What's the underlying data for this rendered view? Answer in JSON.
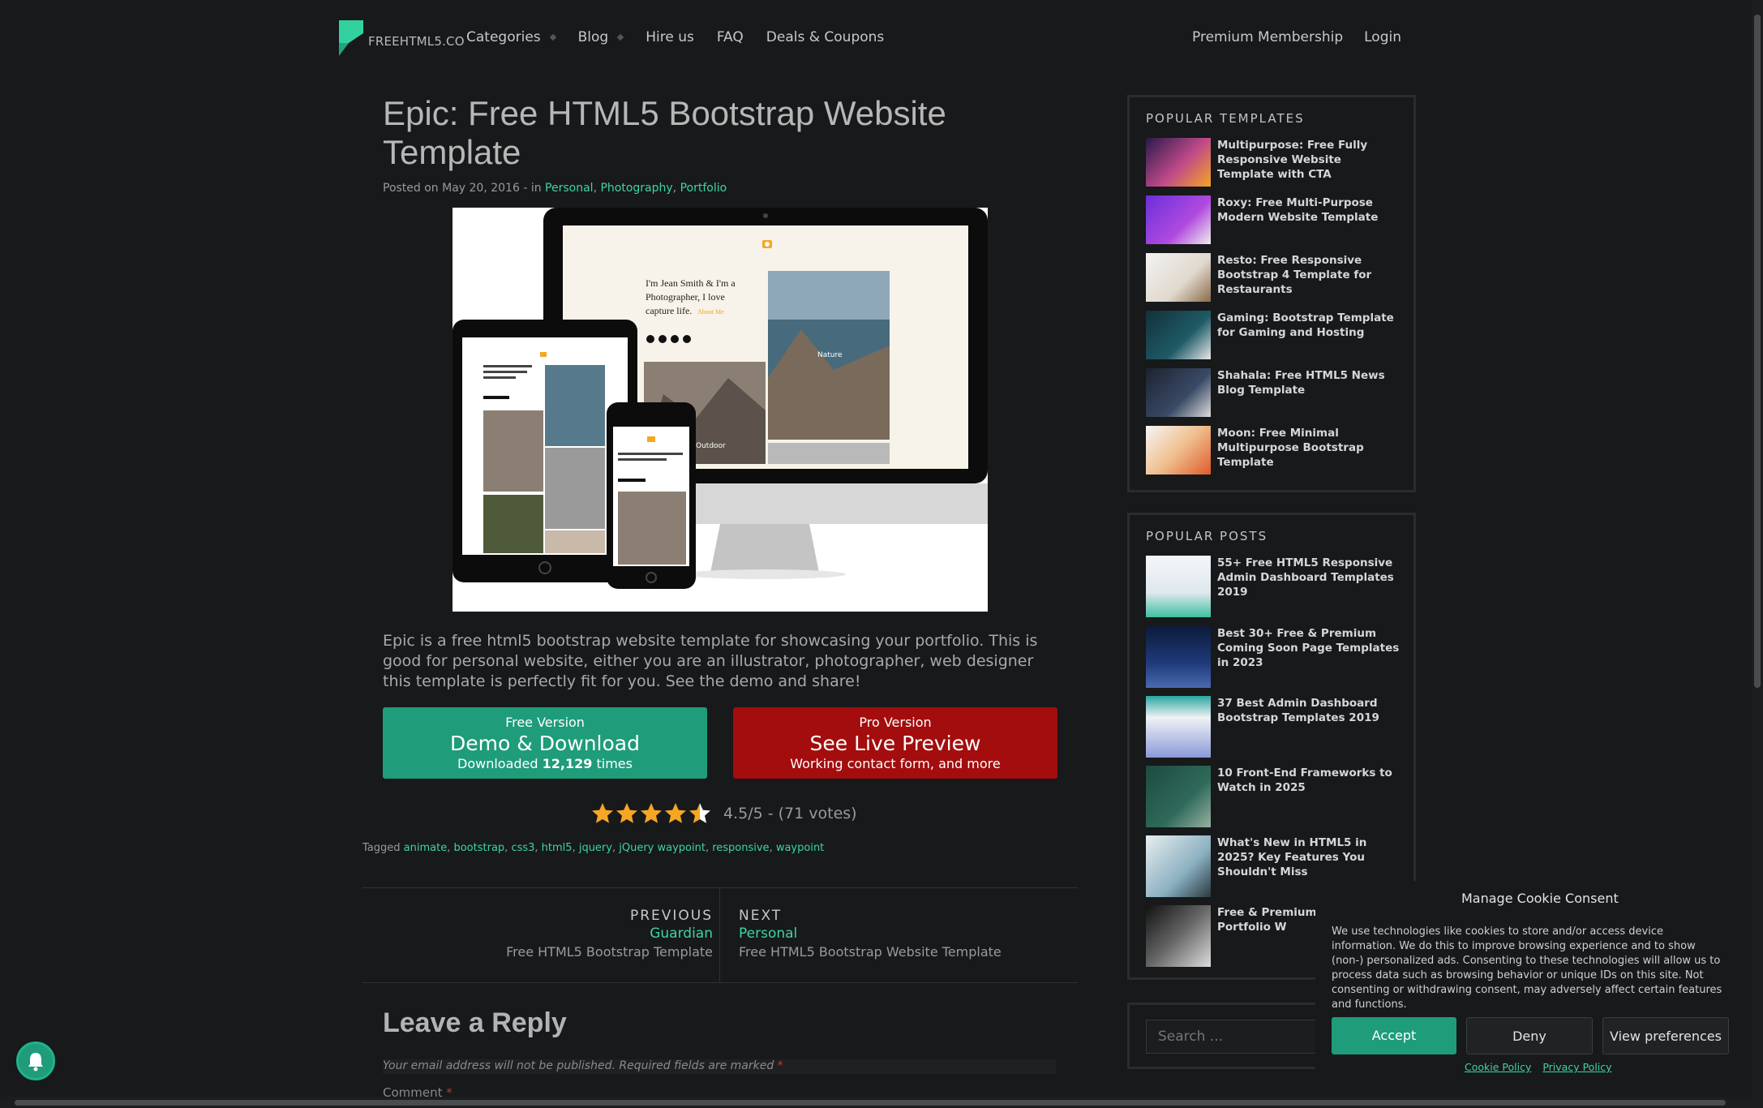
{
  "nav": {
    "logo_text": "FREEHTML5.CO",
    "items": [
      "Categories",
      "Blog",
      "Hire us",
      "FAQ",
      "Deals & Coupons"
    ],
    "right": [
      "Premium Membership",
      "Login"
    ]
  },
  "post": {
    "title": "Epic: Free HTML5 Bootstrap Website Template",
    "meta_prefix": "Posted on May 20, 2016 - in ",
    "categories": [
      "Personal",
      "Photography",
      "Portfolio"
    ],
    "intro": "Epic is a free html5 bootstrap website template for showcasing your portfolio. This is good for personal website, either you are an illustrator, photographer, web designer this template is perfectly fit for you. See the demo and share!",
    "hero": {
      "headline": "I'm Jean Smith & I'm a Photographer, I love capture life.",
      "link": "About Me",
      "tiles": [
        "Nature",
        "Outdoor"
      ]
    }
  },
  "buttons": {
    "free": {
      "small": "Free Version",
      "big": "Demo & Download",
      "sub_prefix": "Downloaded ",
      "count": "12,129",
      "sub_suffix": " times"
    },
    "pro": {
      "small": "Pro Version",
      "big": "See Live Preview",
      "sub": "Working contact form, and more"
    }
  },
  "rating": {
    "value": 4.5,
    "max": 5,
    "text": "4.5/5 - (71 votes)",
    "star_color": "#f5a623"
  },
  "tags": {
    "label": "Tagged ",
    "items": [
      "animate",
      "bootstrap",
      "css3",
      "html5",
      "jquery",
      "jQuery waypoint",
      "responsive",
      "waypoint"
    ]
  },
  "postnav": {
    "prev": {
      "label": "PREVIOUS",
      "name": "Guardian",
      "desc": "Free HTML5 Bootstrap Template"
    },
    "next": {
      "label": "NEXT",
      "name": "Personal",
      "desc": "Free HTML5 Bootstrap Website Template"
    }
  },
  "reply": {
    "title": "Leave a Reply",
    "note": "Your email address will not be published. Required fields are marked ",
    "required_mark": "*",
    "comment_label": "Comment "
  },
  "sidebar": {
    "popular_templates": {
      "title": "POPULAR TEMPLATES",
      "items": [
        "Multipurpose: Free Fully Responsive Website Template with CTA",
        "Roxy: Free Multi-Purpose Modern Website Template",
        "Resto: Free Responsive Bootstrap 4 Template for Restaurants",
        "Gaming: Bootstrap Template for Gaming and Hosting",
        "Shahala: Free HTML5 News Blog Template",
        "Moon: Free Minimal Multipurpose Bootstrap Template"
      ]
    },
    "popular_posts": {
      "title": "POPULAR POSTS",
      "items": [
        "55+ Free HTML5 Responsive Admin Dashboard Templates 2019",
        "Best 30+ Free & Premium Coming Soon Page Templates in 2023",
        "37 Best Admin Dashboard Bootstrap Templates 2019",
        "10 Front-End Frameworks to Watch in 2025",
        "What's New in HTML5 in 2025? Key Features You Shouldn't Miss",
        "Free & Premium Ph Creative Portfolio W"
      ]
    },
    "search_placeholder": "Search ..."
  },
  "cookie": {
    "title": "Manage Cookie Consent",
    "body": "We use technologies like cookies to store and/or access device information. We do this to improve browsing experience and to show (non-) personalized ads. Consenting to these technologies will allow us to process data such as browsing behavior or unique IDs on this site. Not consenting or withdrawing consent, may adversely affect certain features and functions.",
    "accept": "Accept",
    "deny": "Deny",
    "preferences": "View preferences",
    "links": [
      "Cookie Policy",
      "Privacy Policy"
    ]
  },
  "colors": {
    "accent": "#1f9c7a",
    "link": "#3fd3a6",
    "pro": "#a30d0d",
    "background": "#17191b"
  }
}
